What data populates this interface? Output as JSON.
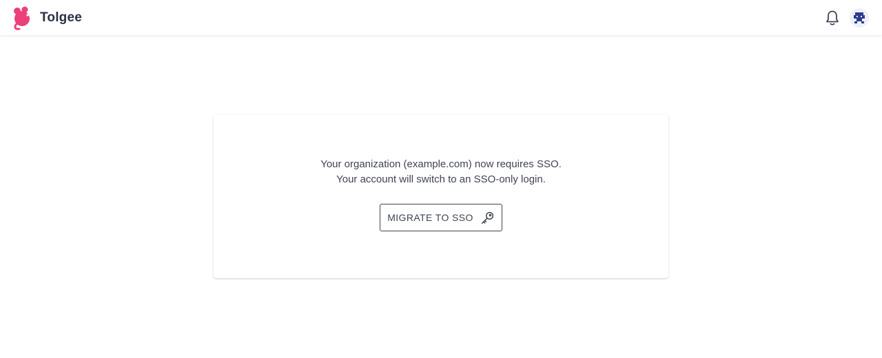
{
  "header": {
    "brand_name": "Tolgee",
    "icons": {
      "logo": "tolgee-mouse-logo",
      "notifications": "bell-icon",
      "user_avatar": "avatar-icon"
    }
  },
  "sso_notice": {
    "message_line_1": "Your organization (example.com) now requires SSO.",
    "message_line_2": "Your account will switch to an SSO-only login.",
    "button_label": "MIGRATE TO SSO",
    "button_icon": "key-icon"
  },
  "colors": {
    "brand_pink": "#ec407a",
    "text": "#3f4454",
    "avatar_blue": "#2c3c8f"
  }
}
